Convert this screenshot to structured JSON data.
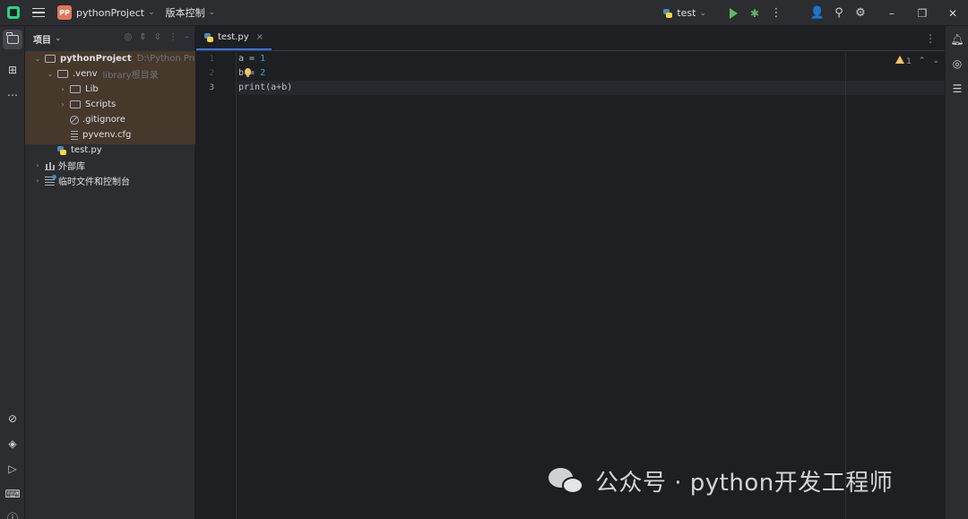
{
  "titlebar": {
    "project_badge": "PP",
    "project_name": "pythonProject",
    "vcs_label": "版本控制",
    "run_config": "test"
  },
  "project_panel": {
    "title": "项目",
    "tree": [
      {
        "label": "pythonProject",
        "hint": "D:\\Python Projects"
      },
      {
        "label": ".venv",
        "hint": "library根目录"
      },
      {
        "label": "Lib"
      },
      {
        "label": "Scripts"
      },
      {
        "label": ".gitignore"
      },
      {
        "label": "pyvenv.cfg"
      },
      {
        "label": "test.py"
      },
      {
        "label": "外部库"
      },
      {
        "label": "临时文件和控制台"
      }
    ]
  },
  "editor": {
    "tab_label": "test.py",
    "line_numbers": [
      "1",
      "2",
      "3"
    ],
    "lines": [
      {
        "var": "a",
        "op": " = ",
        "num": "1"
      },
      {
        "var": "b",
        "op": " = ",
        "num": "2"
      },
      {
        "text": "print(a+b)"
      }
    ],
    "warnings_count": "1"
  },
  "watermark": {
    "text": "公众号 · python开发工程师"
  },
  "colors": {
    "accent": "#3574f0",
    "panel_bg": "#2b2d30",
    "editor_bg": "#1e1f22",
    "tree_highlight": "#46382b",
    "number": "#2aacb8"
  }
}
